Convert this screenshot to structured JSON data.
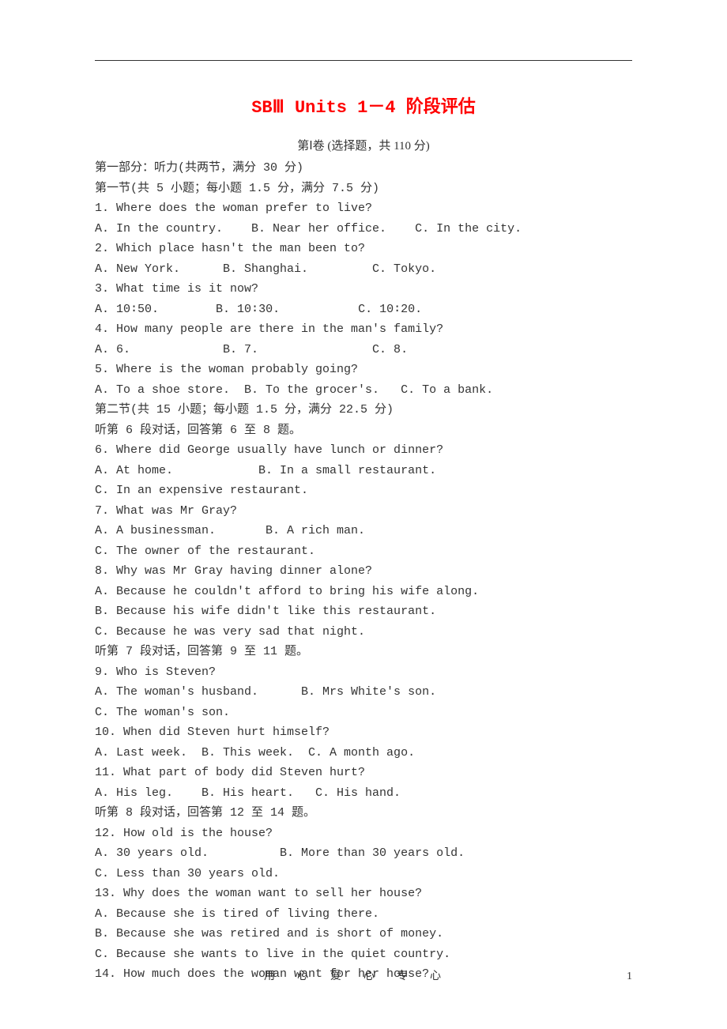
{
  "title": "SBⅢ  Units 1－4 阶段评估",
  "subtitle": "第Ⅰ卷 (选择题，共 110 分)",
  "part1_header": "第一部分：听力(共两节，满分 30 分)",
  "section1_header": "第一节(共 5 小题；每小题 1.5 分，满分 7.5 分)",
  "q1": "1. Where does the woman prefer to live?",
  "q1_opts": "A. In the country.    B. Near her office.    C. In the city.",
  "q2": "2. Which place hasn't the man been to?",
  "q2_opts": "A. New York.      B. Shanghai.         C. Tokyo.",
  "q3": "3. What time is it now?",
  "q3_opts": "A. 10∶50.        B. 10∶30.           C. 10∶20.",
  "q4": "4. How many people are there in the man's family?",
  "q4_opts": "A. 6.             B. 7.                C. 8.",
  "q5": "5. Where is the woman probably going?",
  "q5_opts": "A. To a shoe store.  B. To the grocer's.   C. To a bank.",
  "section2_header": "第二节(共 15 小题；每小题 1.5 分，满分 22.5 分)",
  "dialog6_header": "听第 6 段对话，回答第 6 至 8 题。",
  "q6": "6. Where did George usually have lunch or dinner?",
  "q6_a": "A. At home.            B. In a small restaurant.",
  "q6_c": "C. In an expensive restaurant.",
  "q7": "7. What was Mr Gray?",
  "q7_a": "A. A businessman.       B. A rich man.",
  "q7_c": "C. The owner of the restaurant.",
  "q8": "8. Why was Mr Gray having dinner alone?",
  "q8_a": "A. Because he couldn't afford to bring his wife along.",
  "q8_b": "B. Because his wife didn't like this restaurant.",
  "q8_c": "C. Because he was very sad that night.",
  "dialog7_header": "听第 7 段对话，回答第 9 至 11 题。",
  "q9": "9. Who is Steven?",
  "q9_a": "A. The woman's husband.      B. Mrs White's son.",
  "q9_c": "C. The woman's son.",
  "q10": "10. When did Steven hurt himself?",
  "q10_opts": "A. Last week.  B. This week.  C. A month ago.",
  "q11": "11. What part of body did Steven hurt?",
  "q11_opts": "A. His leg.    B. His heart.   C. His hand.",
  "dialog8_header": "听第 8 段对话，回答第 12 至 14 题。",
  "q12": "12. How old is the house?",
  "q12_a": "A. 30 years old.          B. More than 30 years old.",
  "q12_c": "C. Less than 30 years old.",
  "q13": "13. Why does the woman want to sell her house?",
  "q13_a": "A. Because she is tired of living there.",
  "q13_b": "B. Because she was retired and is short of money.",
  "q13_c": "C. Because she wants to live in the quiet country.",
  "q14": "14. How much does the woman want for her house?",
  "footer_center": "用心爱心专心",
  "footer_page": "1"
}
